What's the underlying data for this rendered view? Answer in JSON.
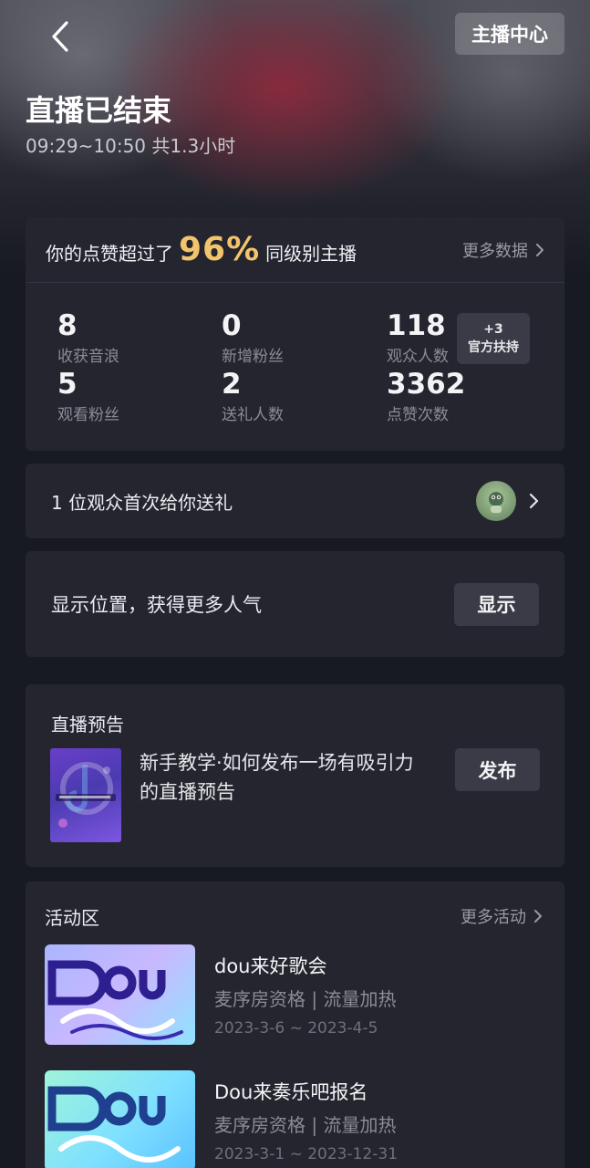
{
  "header": {
    "anchor_center_label": "主播中心",
    "title": "直播已结束",
    "time_range": "09:29~10:50 共1.3小时"
  },
  "summary": {
    "like_prefix": "你的点赞超过了",
    "like_percent": "96%",
    "like_suffix": "同级别主播",
    "more_data_label": "更多数据",
    "stats": [
      {
        "value": "8",
        "label": "收获音浪"
      },
      {
        "value": "0",
        "label": "新增粉丝"
      },
      {
        "value": "118",
        "label": "观众人数"
      },
      {
        "value": "5",
        "label": "观看粉丝"
      },
      {
        "value": "2",
        "label": "送礼人数"
      },
      {
        "value": "3362",
        "label": "点赞次数"
      }
    ],
    "support_count": "+3",
    "support_label": "官方扶持"
  },
  "gift_notice": {
    "text": "1 位观众首次给你送礼"
  },
  "location": {
    "text": "显示位置，获得更多人气",
    "button_label": "显示"
  },
  "preview": {
    "title": "直播预告",
    "description": "新手教学·如何发布一场有吸引力的直播预告",
    "button_label": "发布"
  },
  "activities": {
    "title": "活动区",
    "more_label": "更多活动",
    "items": [
      {
        "name": "dou来好歌会",
        "tags": "麦序房资格 | 流量加热",
        "date": "2023-3-6 ~ 2023-4-5"
      },
      {
        "name": "Dou来奏乐吧报名",
        "tags": "麦序房资格 | 流量加热",
        "date": "2023-3-1 ~ 2023-12-31"
      }
    ]
  },
  "colors": {
    "background": "#171923",
    "card": "#24252f",
    "accent_percent": "#f2c46b"
  }
}
